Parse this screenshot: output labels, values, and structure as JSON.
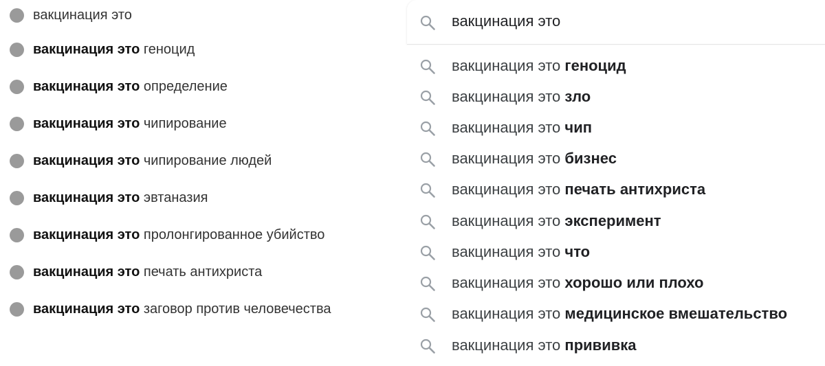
{
  "left_panel": {
    "first_item": "вакцинация это",
    "items": [
      {
        "bold": "вакцинация это",
        "rest": "геноцид"
      },
      {
        "bold": "вакцинация это",
        "rest": "определение"
      },
      {
        "bold": "вакцинация это",
        "rest": "чипирование"
      },
      {
        "bold": "вакцинация это",
        "rest": "чипирование людей"
      },
      {
        "bold": "вакцинация это",
        "rest": "эвтаназия"
      },
      {
        "bold": "вакцинация это",
        "rest": "пролонгированное убийство"
      },
      {
        "bold": "вакцинация это",
        "rest": "печать антихриста"
      },
      {
        "bold": "вакцинация это",
        "rest": "заговор против человечества"
      }
    ]
  },
  "right_panel": {
    "query": "вакцинация это",
    "suggestions": [
      {
        "prefix": "вакцинация это",
        "suffix": "геноцид"
      },
      {
        "prefix": "вакцинация это",
        "suffix": "зло"
      },
      {
        "prefix": "вакцинация это",
        "suffix": "чип"
      },
      {
        "prefix": "вакцинация это",
        "suffix": "бизнес"
      },
      {
        "prefix": "вакцинация это",
        "suffix": "печать антихриста"
      },
      {
        "prefix": "вакцинация это",
        "suffix": "эксперимент"
      },
      {
        "prefix": "вакцинация это",
        "suffix": "что"
      },
      {
        "prefix": "вакцинация это",
        "suffix": "хорошо или плохо"
      },
      {
        "prefix": "вакцинация это",
        "suffix": "медицинское вмешательство"
      },
      {
        "prefix": "вакцинация это",
        "suffix": "прививка"
      }
    ]
  },
  "icons": {
    "left_bullet": "circle-bullet-icon",
    "right_search": "search-icon"
  },
  "colors": {
    "bullet": "#9a9a9a",
    "search_icon": "#9aa0a6",
    "text_dark": "#202124",
    "text_prefix": "#3c4043"
  }
}
